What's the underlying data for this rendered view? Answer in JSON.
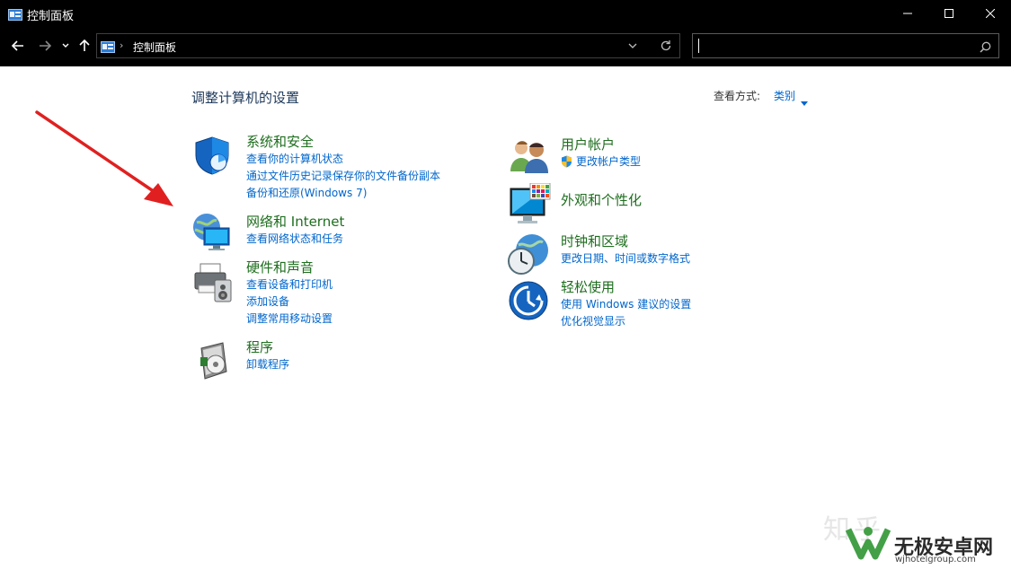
{
  "window": {
    "title": "控制面板",
    "controls": {
      "minimize": "minimize-icon",
      "maximize": "maximize-icon",
      "close": "close-icon"
    }
  },
  "address_bar": {
    "breadcrumb": "控制面板",
    "search_value": ""
  },
  "main": {
    "heading": "调整计算机的设置",
    "view_by_label": "查看方式:",
    "view_mode": "类别"
  },
  "categories_left": [
    {
      "title": "系统和安全",
      "icon": "shield-icon",
      "links": [
        "查看你的计算机状态",
        "通过文件历史记录保存你的文件备份副本",
        "备份和还原(Windows 7)"
      ]
    },
    {
      "title": "网络和 Internet",
      "icon": "network-globe-icon",
      "links": [
        "查看网络状态和任务"
      ]
    },
    {
      "title": "硬件和声音",
      "icon": "printer-speaker-icon",
      "links": [
        "查看设备和打印机",
        "添加设备",
        "调整常用移动设置"
      ]
    },
    {
      "title": "程序",
      "icon": "programs-disc-icon",
      "links": [
        "卸载程序"
      ]
    }
  ],
  "categories_right": [
    {
      "title": "用户帐户",
      "icon": "users-icon",
      "links": [
        "更改帐户类型"
      ]
    },
    {
      "title": "外观和个性化",
      "icon": "monitor-palette-icon",
      "links": []
    },
    {
      "title": "时钟和区域",
      "icon": "clock-globe-icon",
      "links": [
        "更改日期、时间或数字格式"
      ]
    },
    {
      "title": "轻松使用",
      "icon": "ease-of-access-icon",
      "links": [
        "使用 Windows 建议的设置",
        "优化视觉显示"
      ]
    }
  ],
  "watermark": {
    "zhihu": "知乎",
    "brand": "无极安卓网",
    "url": "wjhotelgroup.com"
  },
  "colors": {
    "titlebar_bg": "#000000",
    "category_title": "#1e6e1e",
    "link": "#0066cc",
    "heading": "#1e395b",
    "arrow": "#e02020"
  }
}
